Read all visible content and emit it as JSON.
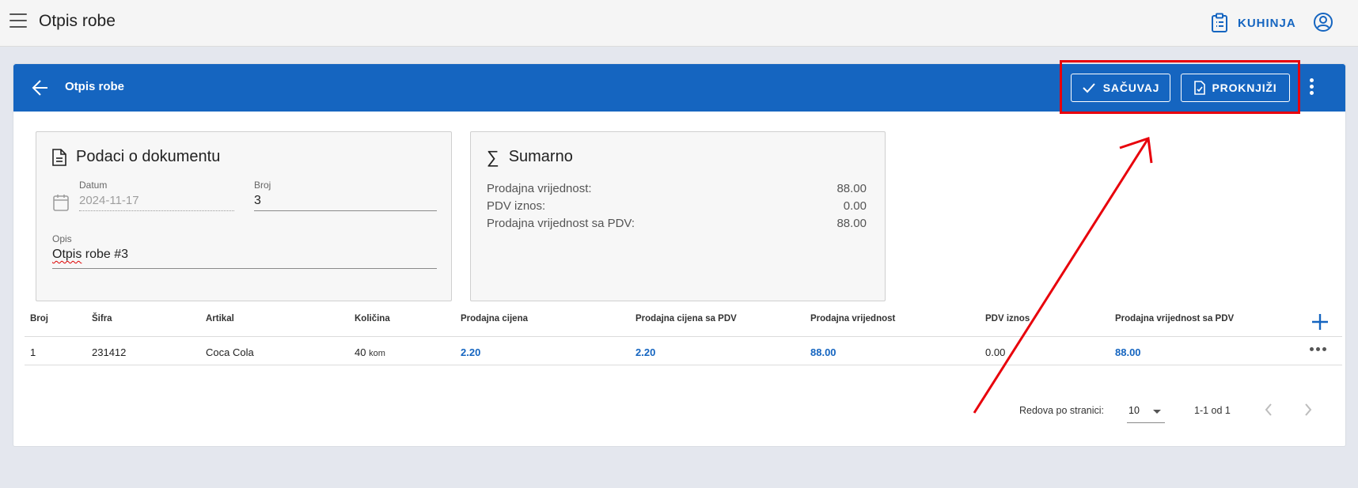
{
  "appbar": {
    "title": "Otpis robe",
    "kitchen_label": "KUHINJA",
    "icons": {
      "menu": "hamburger-icon",
      "kitchen": "clipboard-list-icon",
      "account": "account-circle-icon"
    }
  },
  "toolbar": {
    "title": "Otpis robe",
    "save_label": "SAČUVAJ",
    "post_label": "PROKNJIŽI",
    "icons": {
      "back": "arrow-left-icon",
      "save": "check-icon",
      "post": "file-check-icon",
      "more": "more-vertical-icon"
    }
  },
  "document_panel": {
    "title": "Podaci o dokumentu",
    "date": {
      "label": "Datum",
      "value": "2024-11-17"
    },
    "number": {
      "label": "Broj",
      "value": "3"
    },
    "description": {
      "label": "Opis",
      "value_prefix": "Otpis",
      "value_suffix": " robe #3"
    }
  },
  "summary_panel": {
    "title": "Sumarno",
    "rows": [
      {
        "label": "Prodajna vrijednost:",
        "value": "88.00"
      },
      {
        "label": "PDV iznos:",
        "value": "0.00"
      },
      {
        "label": "Prodajna vrijednost sa PDV:",
        "value": "88.00"
      }
    ]
  },
  "table": {
    "columns": [
      "Broj",
      "Šifra",
      "Artikal",
      "Količina",
      "Prodajna cijena",
      "Prodajna cijena sa PDV",
      "Prodajna vrijednost",
      "PDV iznos",
      "Prodajna vrijednost sa PDV"
    ],
    "rows": [
      {
        "broj": "1",
        "sifra": "231412",
        "artikal": "Coca Cola",
        "kolicina": "40",
        "jedinica": "kom",
        "prodajna_cijena": "2.20",
        "prodajna_cijena_pdv": "2.20",
        "prodajna_vrijednost": "88.00",
        "pdv_iznos": "0.00",
        "prodajna_vrijednost_pdv": "88.00"
      }
    ]
  },
  "pagination": {
    "rows_per_page_label": "Redova po stranici:",
    "rows_per_page": "10",
    "range": "1-1 od 1"
  },
  "colors": {
    "primary": "#1565c0",
    "annotation": "#e8000b",
    "background": "#e4e7ee"
  }
}
